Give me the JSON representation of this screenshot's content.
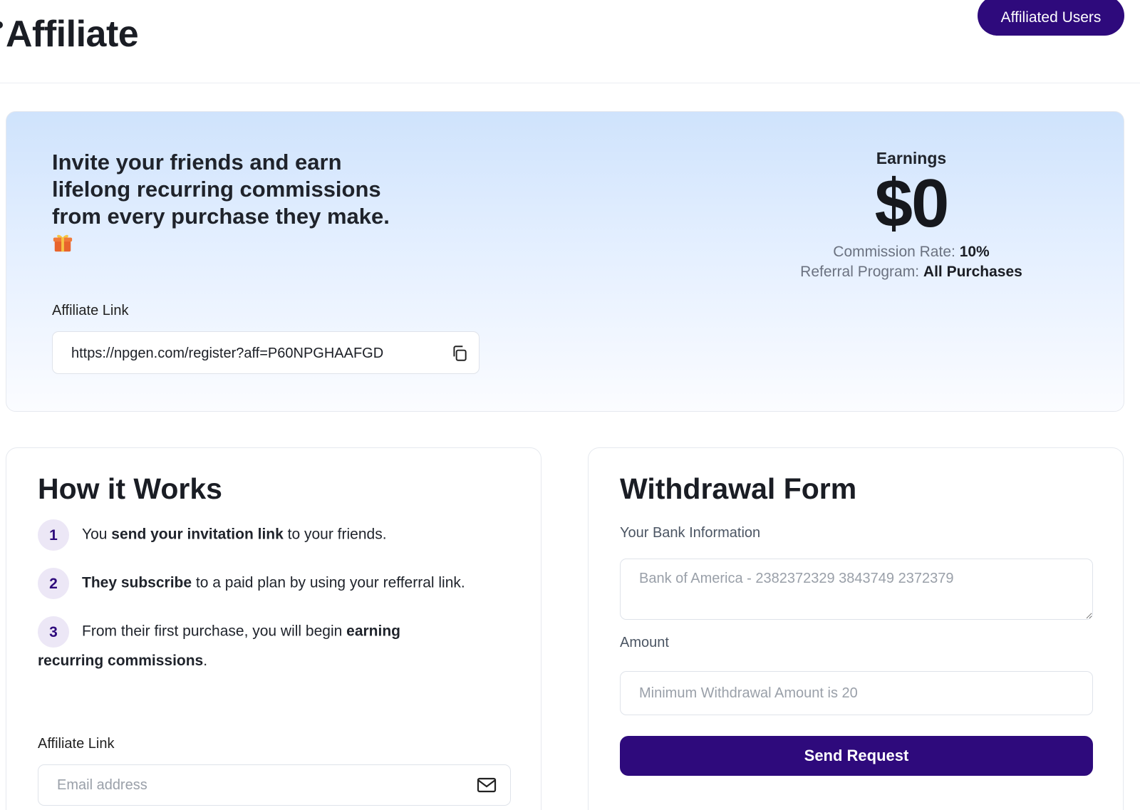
{
  "header": {
    "title": "Affiliate",
    "affiliated_users_label": "Affiliated Users"
  },
  "hero": {
    "title": "Invite your friends and earn lifelong recurring commissions from every purchase they make.",
    "gift_icon": "gift-icon",
    "affiliate_link_label": "Affiliate Link",
    "affiliate_link": "https://npgen.com/register?aff=P60NPGHAAFGD",
    "earnings_label": "Earnings",
    "earnings_amount": "$0",
    "commission_rate_label": "Commission Rate:",
    "commission_rate_value": "10%",
    "referral_program_label": "Referral Program:",
    "referral_program_value": "All Purchases"
  },
  "how_it_works": {
    "title": "How it Works",
    "steps": [
      {
        "num": "1",
        "pre": "You ",
        "bold": "send your invitation link",
        "post": " to your friends."
      },
      {
        "num": "2",
        "pre": "",
        "bold": "They subscribe",
        "post": " to a paid plan by using your refferral link."
      },
      {
        "num": "3",
        "pre": "From their first purchase, you will begin ",
        "bold": "earning recurring commissions",
        "post": "."
      }
    ],
    "affiliate_link_label": "Affiliate Link",
    "email_placeholder": "Email address"
  },
  "withdrawal": {
    "title": "Withdrawal Form",
    "bank_label": "Your Bank Information",
    "bank_placeholder": "Bank of America - 2382372329 3843749 2372379",
    "amount_label": "Amount",
    "amount_placeholder": "Minimum Withdrawal Amount is 20",
    "send_label": "Send Request"
  },
  "colors": {
    "accent": "#2e0a7c",
    "step_bg": "#ece7f6",
    "hero_top": "#cfe3fc"
  }
}
